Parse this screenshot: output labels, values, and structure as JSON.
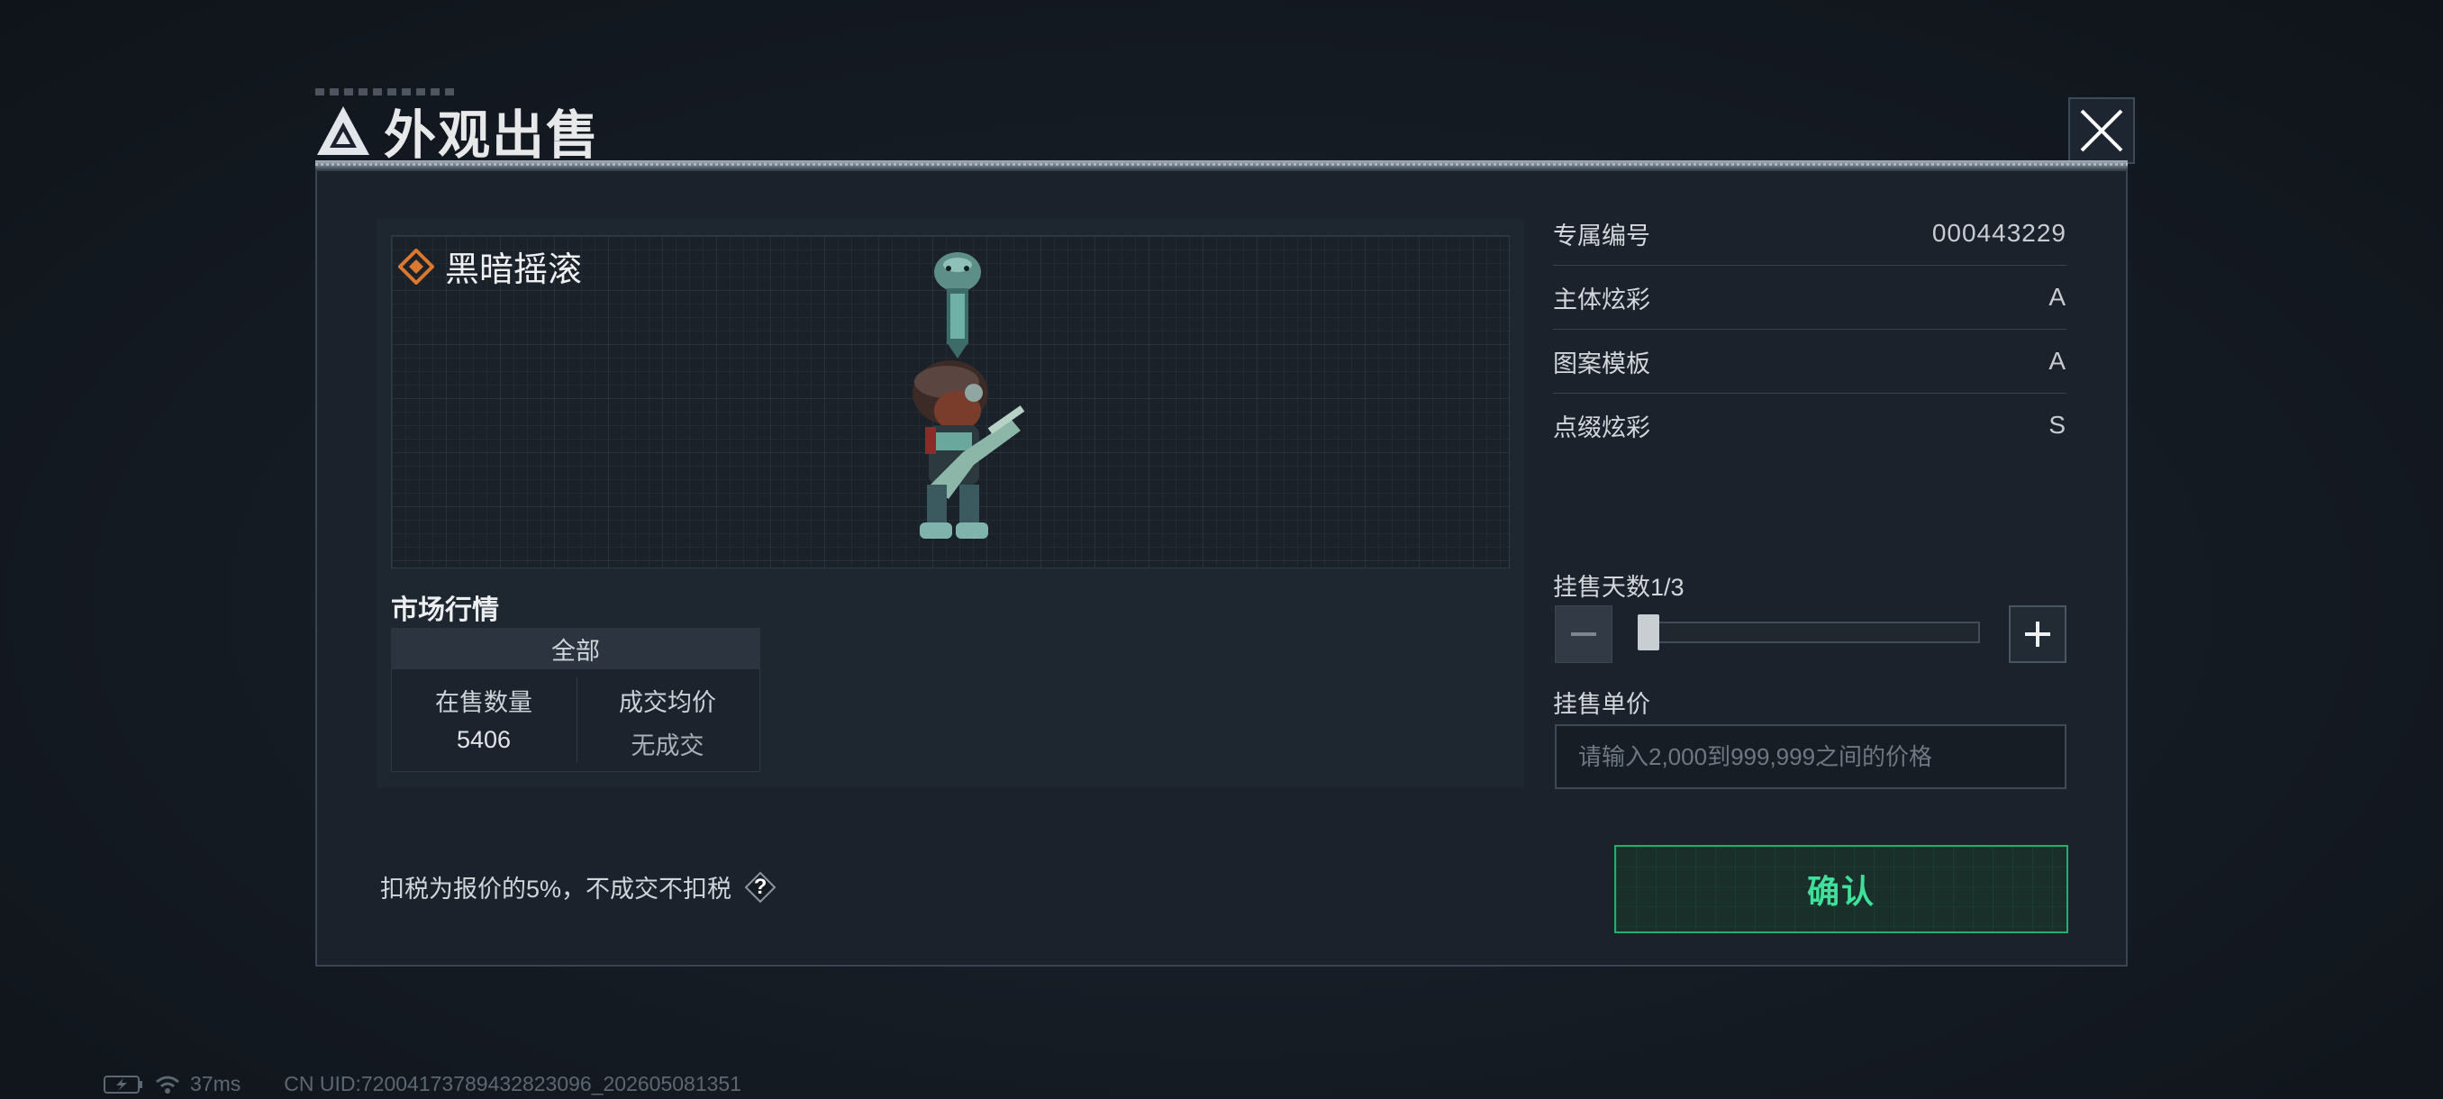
{
  "header": {
    "title": "外观出售"
  },
  "item": {
    "name": "黑暗摇滚"
  },
  "market": {
    "title": "市场行情",
    "filter": "全部",
    "columns": [
      {
        "label": "在售数量",
        "value": "5406"
      },
      {
        "label": "成交均价",
        "value": "无成交"
      }
    ]
  },
  "attributes": [
    {
      "label": "专属编号",
      "value": "000443229"
    },
    {
      "label": "主体炫彩",
      "value": "A"
    },
    {
      "label": "图案模板",
      "value": "A"
    },
    {
      "label": "点缀炫彩",
      "value": "S"
    }
  ],
  "listing": {
    "days_label": "挂售天数1/3",
    "days_current": 1,
    "days_max": 3,
    "price_label": "挂售单价",
    "price_placeholder": "请输入2,000到999,999之间的价格"
  },
  "footer": {
    "tax_note": "扣税为报价的5%，不成交不扣税",
    "help_glyph": "?",
    "confirm_label": "确认"
  },
  "status": {
    "latency": "37ms",
    "uid": "CN UID:720041737894328230​96_202605081351"
  },
  "colors": {
    "accent_green": "#3fe19a",
    "rarity_orange": "#d9782e"
  },
  "icons": [
    "brand-logo-icon",
    "close-icon",
    "rarity-diamond-icon",
    "minus-icon",
    "plus-icon",
    "help-icon",
    "battery-icon",
    "wifi-icon"
  ]
}
